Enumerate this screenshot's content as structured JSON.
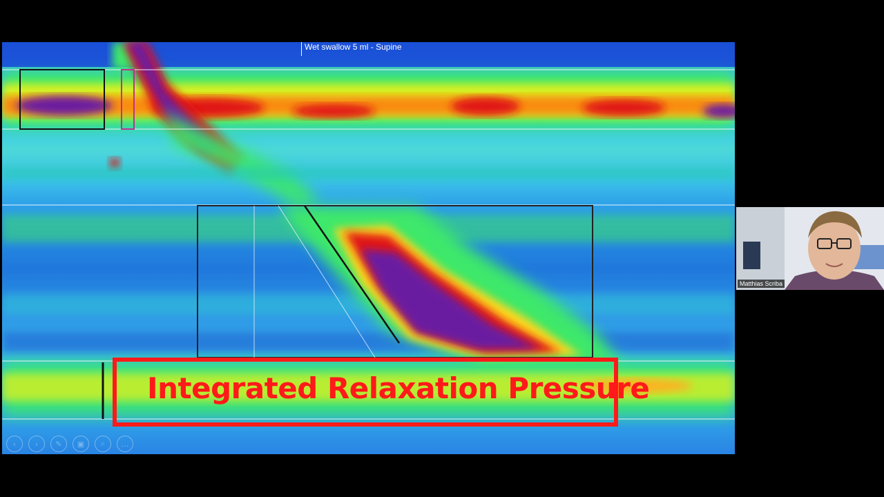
{
  "slide": {
    "title": "Wet swallow 5 ml - Supine",
    "annotation_label": "Integrated Relaxation Pressure",
    "controls": [
      {
        "icon": "previous-icon",
        "glyph": "‹"
      },
      {
        "icon": "next-icon",
        "glyph": "›"
      },
      {
        "icon": "pen-icon",
        "glyph": "✎"
      },
      {
        "icon": "slides-icon",
        "glyph": "▣"
      },
      {
        "icon": "zoom-icon",
        "glyph": "⌕"
      },
      {
        "icon": "more-icon",
        "glyph": "…"
      }
    ]
  },
  "video": {
    "participant_name": "Matthias Scriba"
  },
  "colors": {
    "annotation_red": "#ff1a1a",
    "high_pressure": "#6a1aa0",
    "background": "#000000"
  }
}
